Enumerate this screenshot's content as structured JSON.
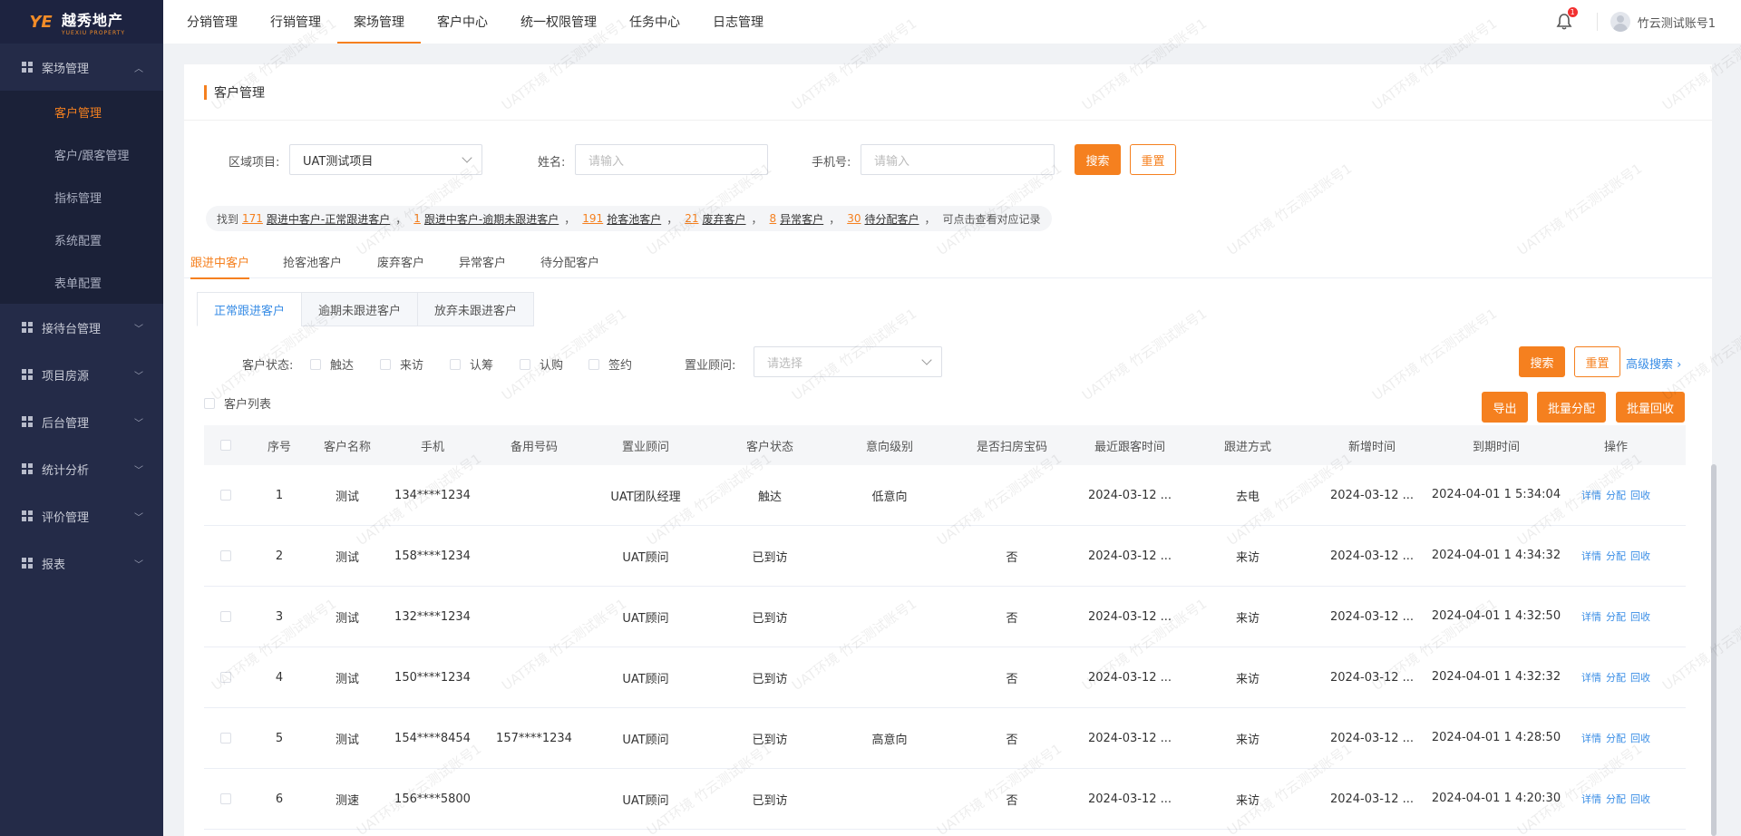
{
  "app": {
    "logo_mark": "YE",
    "logo_cn": "越秀地产",
    "logo_en": "YUEXIU PROPERTY"
  },
  "sidebar": {
    "groups": [
      {
        "label": "案场管理",
        "expanded": true,
        "items": [
          {
            "label": "客户管理",
            "active": true
          },
          {
            "label": "客户/跟客管理"
          },
          {
            "label": "指标管理"
          },
          {
            "label": "系统配置"
          },
          {
            "label": "表单配置"
          }
        ]
      },
      {
        "label": "接待台管理"
      },
      {
        "label": "项目房源"
      },
      {
        "label": "后台管理"
      },
      {
        "label": "统计分析"
      },
      {
        "label": "评价管理"
      },
      {
        "label": "报表"
      }
    ]
  },
  "topnav": {
    "items": [
      "分销管理",
      "行销管理",
      "案场管理",
      "客户中心",
      "统一权限管理",
      "任务中心",
      "日志管理"
    ],
    "active_index": 2,
    "notification_count": "1",
    "username": "竹云测试账号1"
  },
  "page": {
    "title": "客户管理"
  },
  "filters": {
    "region_label": "区域项目:",
    "region_value": "UAT测试项目",
    "name_label": "姓名:",
    "name_placeholder": "请输入",
    "phone_label": "手机号:",
    "phone_placeholder": "请输入",
    "search": "搜索",
    "reset": "重置"
  },
  "summary": {
    "prefix": "找到",
    "items": [
      {
        "num": "171",
        "label": "跟进中客户-正常跟进客户"
      },
      {
        "num": "1",
        "label": "跟进中客户-逾期未跟进客户"
      },
      {
        "num": "191",
        "label": "抢客池客户"
      },
      {
        "num": "21",
        "label": "废弃客户"
      },
      {
        "num": "8",
        "label": "异常客户"
      },
      {
        "num": "30",
        "label": "待分配客户"
      }
    ],
    "suffix": "可点击查看对应记录"
  },
  "tabs": [
    "跟进中客户",
    "抢客池客户",
    "废弃客户",
    "异常客户",
    "待分配客户"
  ],
  "subtabs": [
    "正常跟进客户",
    "逾期未跟进客户",
    "放弃未跟进客户"
  ],
  "status_filter": {
    "label": "客户状态:",
    "options": [
      "触达",
      "来访",
      "认筹",
      "认购",
      "签约"
    ],
    "consultant_label": "置业顾问:",
    "consultant_placeholder": "请选择",
    "search": "搜索",
    "reset": "重置",
    "advanced": "高级搜索"
  },
  "list": {
    "label": "客户列表",
    "export": "导出",
    "batch_assign": "批量分配",
    "batch_recall": "批量回收"
  },
  "table": {
    "columns": [
      "序号",
      "客户名称",
      "手机",
      "备用号码",
      "置业顾问",
      "客户状态",
      "意向级别",
      "是否扫房宝码",
      "最近跟客时间",
      "跟进方式",
      "新增时间",
      "到期时间",
      "操作"
    ],
    "rows": [
      [
        "1",
        "测试",
        "134****1234",
        "",
        "UAT团队经理",
        "触达",
        "低意向",
        "",
        "2024-03-12 ...",
        "去电",
        "2024-03-12 ...",
        "2024-04-01 1 5:34:04"
      ],
      [
        "2",
        "测试",
        "158****1234",
        "",
        "UAT顾问",
        "已到访",
        "",
        "否",
        "2024-03-12 ...",
        "来访",
        "2024-03-12 ...",
        "2024-04-01 1 4:34:32"
      ],
      [
        "3",
        "测试",
        "132****1234",
        "",
        "UAT顾问",
        "已到访",
        "",
        "否",
        "2024-03-12 ...",
        "来访",
        "2024-03-12 ...",
        "2024-04-01 1 4:32:50"
      ],
      [
        "4",
        "测试",
        "150****1234",
        "",
        "UAT顾问",
        "已到访",
        "",
        "否",
        "2024-03-12 ...",
        "来访",
        "2024-03-12 ...",
        "2024-04-01 1 4:32:32"
      ],
      [
        "5",
        "测试",
        "154****8454",
        "157****1234",
        "UAT顾问",
        "已到访",
        "高意向",
        "否",
        "2024-03-12 ...",
        "来访",
        "2024-03-12 ...",
        "2024-04-01 1 4:28:50"
      ],
      [
        "6",
        "测速",
        "156****5800",
        "",
        "UAT顾问",
        "已到访",
        "",
        "否",
        "2024-03-12 ...",
        "来访",
        "2024-03-12 ...",
        "2024-04-01 1 4:20:30"
      ]
    ],
    "ops": [
      "详情",
      "分配",
      "回收"
    ]
  },
  "watermark": "UAT环境 竹云测试账号1",
  "colors": {
    "accent": "#f5801f",
    "link": "#3a8ee6",
    "sidebar": "#242b48"
  }
}
